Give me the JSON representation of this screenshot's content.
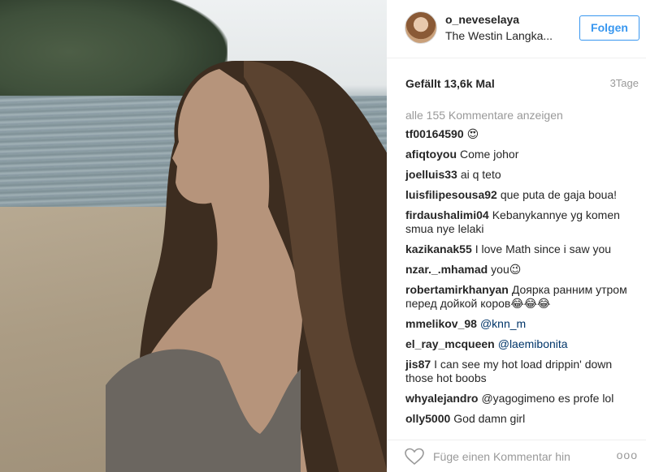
{
  "post": {
    "username": "o_neveselaya",
    "location": "The Westin Langka...",
    "follow_label": "Folgen",
    "likes": "Gefällt 13,6k Mal",
    "time": "3Tage",
    "view_all": "alle 155 Kommentare anzeigen"
  },
  "comments": [
    {
      "user": "tf00164590",
      "text": "😍"
    },
    {
      "user": "afiqtoyou",
      "text": "Come johor"
    },
    {
      "user": "joelluis33",
      "text": "ai q teto"
    },
    {
      "user": "luisfilipesousa92",
      "text": "que puta de gaja boua!"
    },
    {
      "user": "firdaushalimi04",
      "text": "Kebanykannye yg komen smua nye lelaki"
    },
    {
      "user": "kazikanak55",
      "text": "I love Math since i saw you"
    },
    {
      "user": "nzar._.mhamad",
      "text": "you😉"
    },
    {
      "user": "robertamirkhanyan",
      "text": "Доярка ранним утром перед дойкой коров😂😂😂"
    },
    {
      "user": "mmelikov_98",
      "text": "@knn_m"
    },
    {
      "user": "el_ray_mcqueen",
      "text": "@laemibonita"
    },
    {
      "user": "jis87",
      "text": "I can see my hot load drippin' down those hot boobs"
    },
    {
      "user": "whyalejandro",
      "text": "@yagogimeno es profe lol"
    },
    {
      "user": "olly5000",
      "text": "God damn girl"
    }
  ],
  "add_comment": {
    "placeholder": "Füge einen Kommentar hin",
    "more": "ooo"
  },
  "icons": {
    "heart": "heart-icon",
    "avatar": "avatar-image",
    "more": "more-options-icon"
  }
}
